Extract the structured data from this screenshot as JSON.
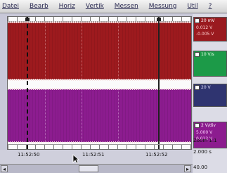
{
  "menu": {
    "items": [
      "Datei",
      "Bearb",
      "Horiz",
      "Vertik",
      "Messen",
      "Messung",
      "Util",
      "?"
    ]
  },
  "channels": [
    {
      "value1": "20 mV",
      "value2": "0.012 V",
      "value3": "-0.005 V",
      "color": "#9d1a1e"
    },
    {
      "value1": "10 V/s",
      "value2": "",
      "value3": "",
      "color": "#1c9a48"
    },
    {
      "value1": "20 V",
      "value2": "",
      "value3": "",
      "color": "#2f3470"
    },
    {
      "value1": "2 V/div",
      "value2": "5.000 V",
      "value3": "0.012 V",
      "color": "#8c1c8f"
    }
  ],
  "side": {
    "zoom_label": "Zoom 1:1",
    "rate": "2.000 s",
    "bottom": "40.00"
  },
  "time_axis": {
    "labels": [
      "11:52:50",
      "11:52:51",
      "11:52:52"
    ]
  },
  "colors": {
    "trace_top": "#9d1a1e",
    "trace_bottom": "#8c1c8f",
    "background": "#c8c8d8"
  }
}
